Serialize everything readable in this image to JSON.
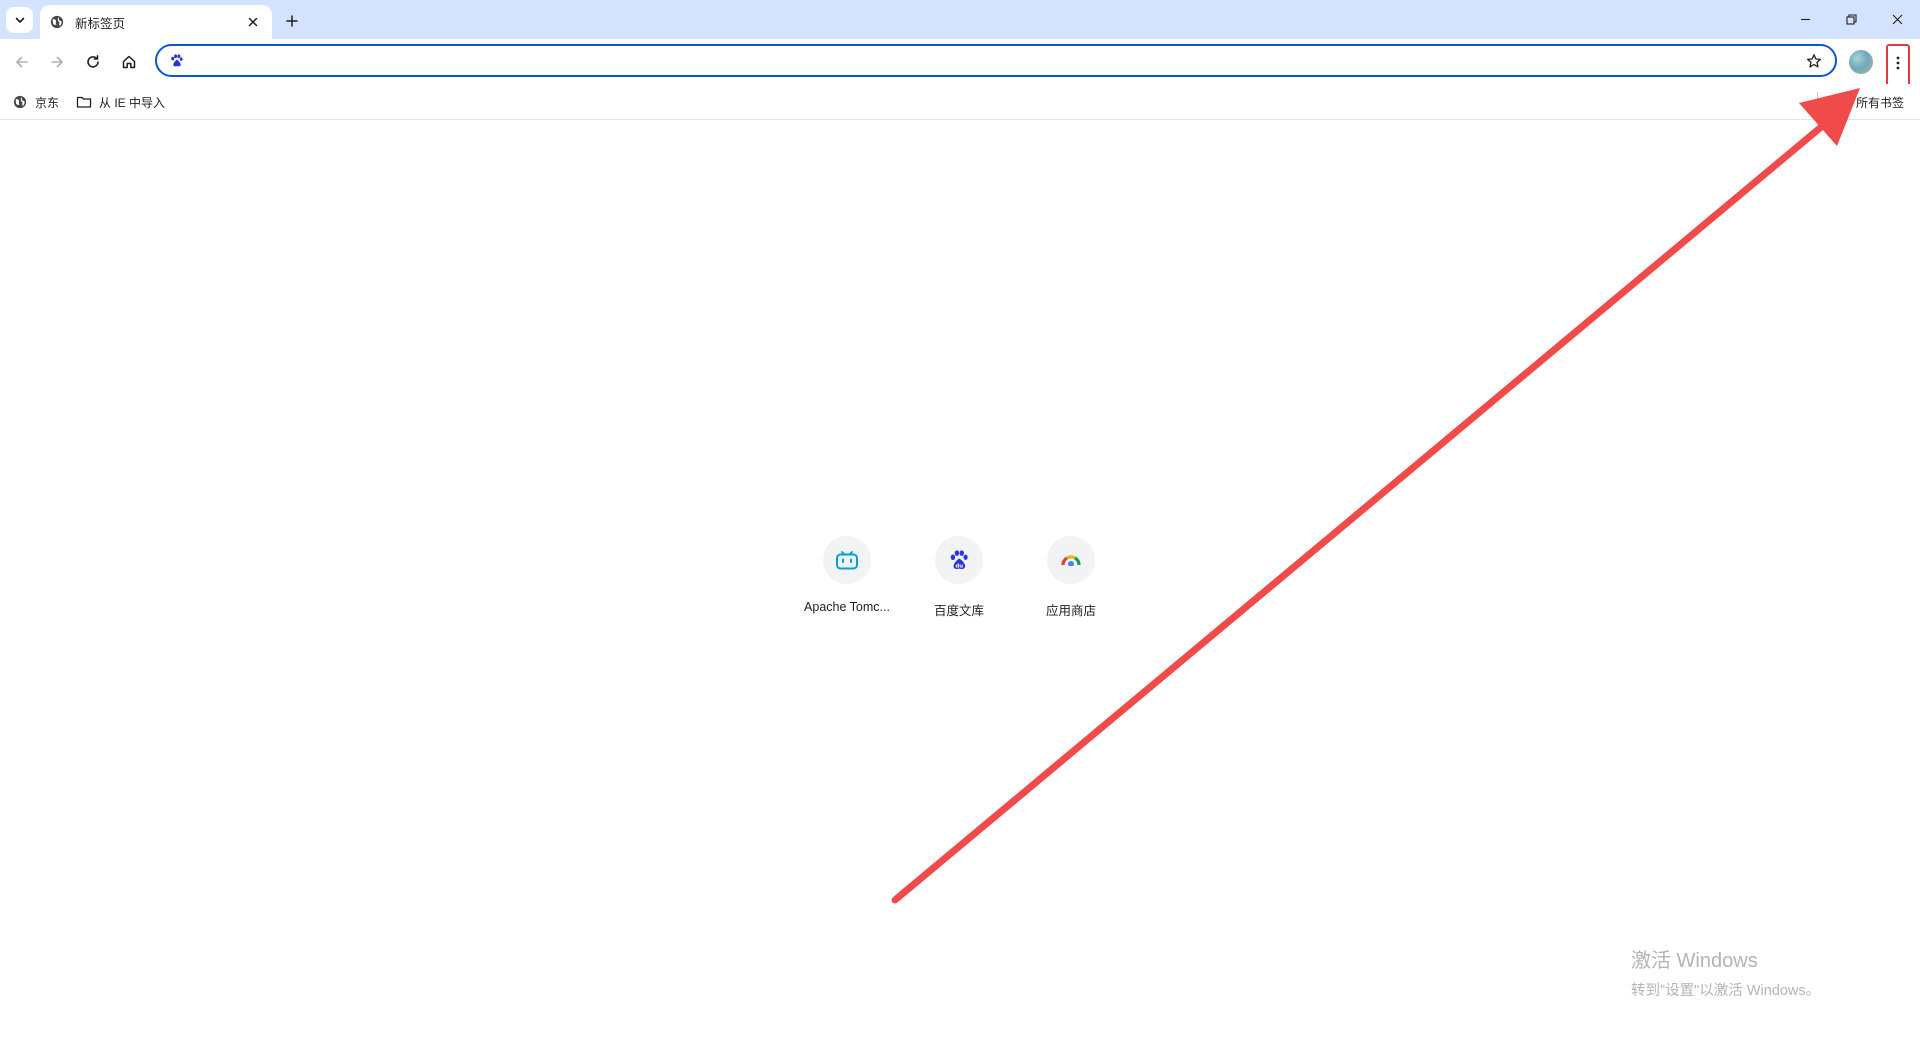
{
  "tabstrip": {
    "tab_title": "新标签页",
    "tab_favicon": "globe-icon"
  },
  "toolbar": {
    "omnibox_value": "",
    "omnibox_site_icon": "baidu-paw-icon",
    "highlight_color": "#e23b3b",
    "accent_color": "#0b57d0"
  },
  "bookmarks": {
    "items": [
      {
        "label": "京东",
        "icon": "globe-icon"
      },
      {
        "label": "从 IE 中导入",
        "icon": "folder-icon"
      }
    ],
    "all_bookmarks_label": "所有书签"
  },
  "shortcuts": [
    {
      "label": "Apache Tomc...",
      "icon": "bilibili-tv-icon"
    },
    {
      "label": "百度文库",
      "icon": "baidu-paw-icon"
    },
    {
      "label": "应用商店",
      "icon": "webstore-icon"
    }
  ],
  "watermark": {
    "line1": "激活 Windows",
    "line2": "转到\"设置\"以激活 Windows。"
  }
}
